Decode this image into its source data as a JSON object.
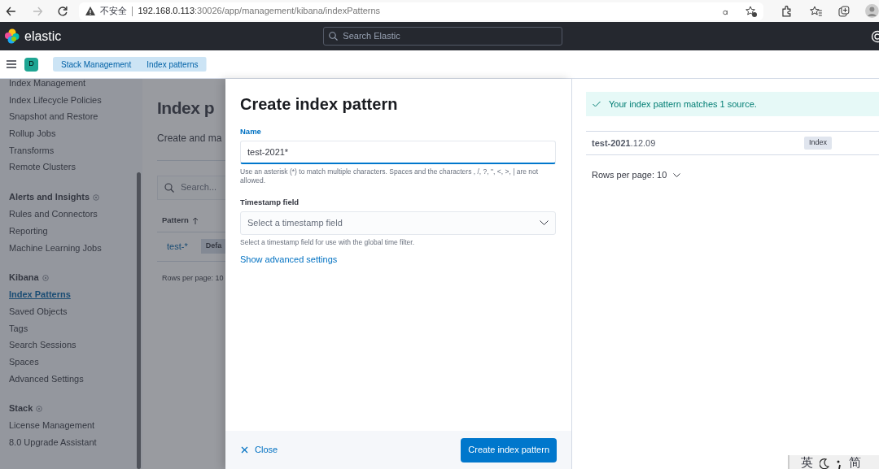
{
  "browser": {
    "security": "不安全",
    "url_host": "192.168.0.113",
    "url_path": ":30026/app/management/kibana/indexPatterns"
  },
  "header": {
    "brand": "elastic",
    "search_placeholder": "Search Elastic"
  },
  "breadcrumbs": {
    "avatar": "D",
    "items": [
      "Stack Management",
      "Index patterns"
    ]
  },
  "sidebar": {
    "groups": [
      {
        "items": [
          {
            "label": "Index Management",
            "selected": false
          },
          {
            "label": "Index Lifecycle Policies",
            "selected": false
          },
          {
            "label": "Snapshot and Restore",
            "selected": false
          },
          {
            "label": "Rollup Jobs",
            "selected": false
          },
          {
            "label": "Transforms",
            "selected": false
          },
          {
            "label": "Remote Clusters",
            "selected": false
          }
        ]
      },
      {
        "title": "Alerts and Insights",
        "items": [
          {
            "label": "Rules and Connectors",
            "selected": false
          },
          {
            "label": "Reporting",
            "selected": false
          },
          {
            "label": "Machine Learning Jobs",
            "selected": false
          }
        ]
      },
      {
        "title": "Kibana",
        "items": [
          {
            "label": "Index Patterns",
            "selected": true
          },
          {
            "label": "Saved Objects",
            "selected": false
          },
          {
            "label": "Tags",
            "selected": false
          },
          {
            "label": "Search Sessions",
            "selected": false
          },
          {
            "label": "Spaces",
            "selected": false
          },
          {
            "label": "Advanced Settings",
            "selected": false
          }
        ]
      },
      {
        "title": "Stack",
        "items": [
          {
            "label": "License Management",
            "selected": false
          },
          {
            "label": "8.0 Upgrade Assistant",
            "selected": false
          }
        ]
      }
    ]
  },
  "page": {
    "title": "Index p",
    "subtitle": "Create and ma",
    "search_placeholder": "Search...",
    "column": "Pattern",
    "row": {
      "pattern": "test-*",
      "badge": "Defa"
    },
    "rows_per_page": "Rows per page: 10"
  },
  "flyout": {
    "title": "Create index pattern",
    "name_label": "Name",
    "name_value": "test-2021*",
    "name_help": "Use an asterisk (*) to match multiple characters. Spaces and the characters , /, ?, \", <, >, | are not allowed.",
    "timestamp_label": "Timestamp field",
    "timestamp_placeholder": "Select a timestamp field",
    "timestamp_help": "Select a timestamp field for use with the global time filter.",
    "advanced_link": "Show advanced settings",
    "close": "Close",
    "create_button": "Create index pattern"
  },
  "preview": {
    "callout": "Your index pattern matches 1 source.",
    "rows": [
      {
        "name": "**test-2021**.12.09",
        "tag": "Index"
      }
    ],
    "rows_per_page": "Rows per page: 10"
  },
  "ime": [
    "英",
    "简"
  ]
}
